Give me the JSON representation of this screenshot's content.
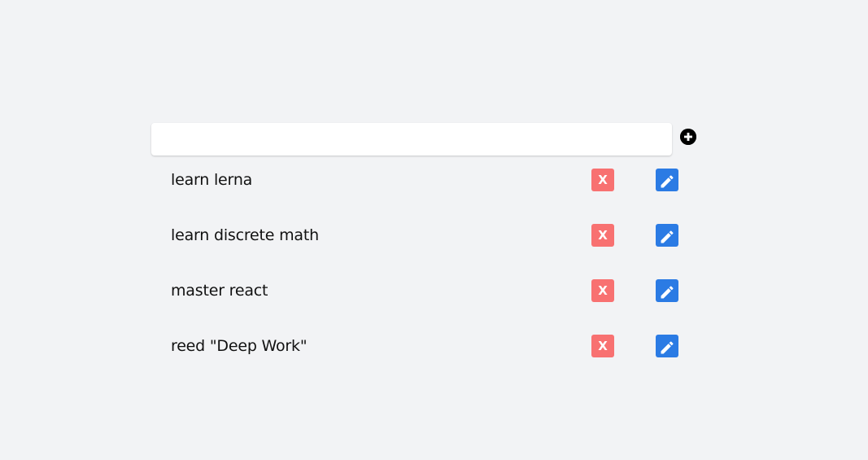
{
  "input": {
    "value": "",
    "placeholder": ""
  },
  "add_button": {
    "icon": "plus-circle-icon"
  },
  "todos": [
    {
      "text": "learn lerna",
      "delete_label": "X",
      "edit_icon": "pencil-icon"
    },
    {
      "text": "learn discrete math",
      "delete_label": "X",
      "edit_icon": "pencil-icon"
    },
    {
      "text": "master react",
      "delete_label": "X",
      "edit_icon": "pencil-icon"
    },
    {
      "text": "reed \"Deep Work\"",
      "delete_label": "X",
      "edit_icon": "pencil-icon"
    }
  ],
  "colors": {
    "background": "#f2f3f5",
    "delete": "#f87171",
    "edit": "#2b7be4"
  }
}
